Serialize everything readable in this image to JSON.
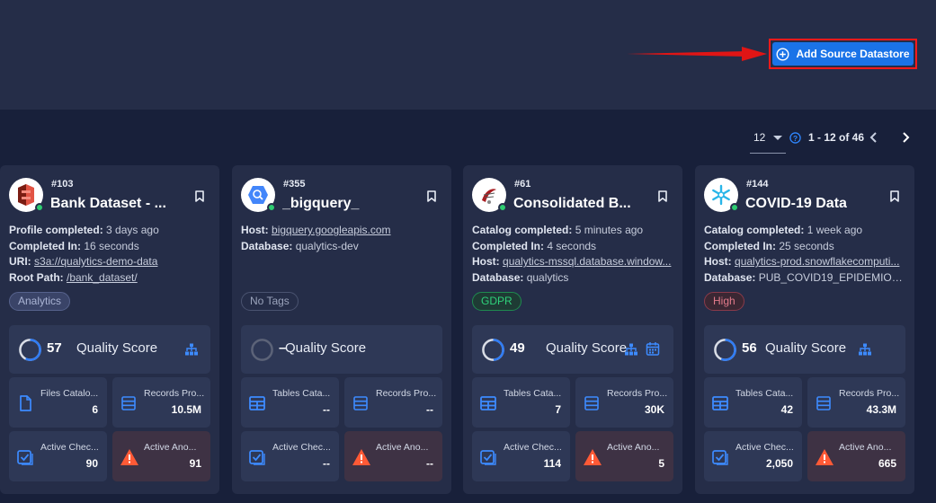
{
  "header": {
    "add_button_label": "Add Source Datastore"
  },
  "pagination": {
    "page_size": "12",
    "range": "1 - 12 of 46"
  },
  "cards": [
    {
      "id": "#103",
      "name": "Bank Dataset - ...",
      "logo": "aws-s3-icon",
      "status_color": "#2ecc71",
      "details": [
        {
          "label": "Profile completed:",
          "value": "3 days ago",
          "link": false
        },
        {
          "label": "Completed In:",
          "value": "16 seconds",
          "link": false
        },
        {
          "label": "URI:",
          "value": "s3a://qualytics-demo-data",
          "link": true
        },
        {
          "label": "Root Path:",
          "value": "/bank_dataset/",
          "link": true
        }
      ],
      "tag": "Analytics",
      "quality_score": "57",
      "quality_score_label": "Quality Score",
      "quality_score_fraction": 0.57,
      "stats": [
        {
          "label": "Files Catalo...",
          "value": "6",
          "icon": "file-icon"
        },
        {
          "label": "Records Pro...",
          "value": "10.5M",
          "icon": "records-icon"
        },
        {
          "label": "Active Chec...",
          "value": "90",
          "icon": "checks-icon"
        },
        {
          "label": "Active Ano...",
          "value": "91",
          "icon": "warning-icon"
        }
      ]
    },
    {
      "id": "#355",
      "name": "_bigquery_",
      "logo": "bigquery-icon",
      "status_color": "#2ecc71",
      "details": [
        {
          "label": "Host:",
          "value": "bigquery.googleapis.com",
          "link": true
        },
        {
          "label": "Database:",
          "value": "qualytics-dev",
          "link": false
        }
      ],
      "tag": "No Tags",
      "quality_score": "–",
      "quality_score_label": "Quality Score",
      "quality_score_fraction": 0,
      "stats": [
        {
          "label": "Tables Cata...",
          "value": "--",
          "icon": "table-icon"
        },
        {
          "label": "Records Pro...",
          "value": "--",
          "icon": "records-icon"
        },
        {
          "label": "Active Chec...",
          "value": "--",
          "icon": "checks-icon"
        },
        {
          "label": "Active Ano...",
          "value": "--",
          "icon": "warning-icon"
        }
      ]
    },
    {
      "id": "#61",
      "name": "Consolidated B...",
      "logo": "sql-server-icon",
      "status_color": "#2ecc71",
      "details": [
        {
          "label": "Catalog completed:",
          "value": "5 minutes ago",
          "link": false
        },
        {
          "label": "Completed In:",
          "value": "4 seconds",
          "link": false
        },
        {
          "label": "Host:",
          "value": "qualytics-mssql.database.window...",
          "link": true
        },
        {
          "label": "Database:",
          "value": "qualytics",
          "link": false
        }
      ],
      "tag": "GDPR",
      "quality_score": "49",
      "quality_score_label": "Quality Score",
      "quality_score_fraction": 0.49,
      "stats": [
        {
          "label": "Tables Cata...",
          "value": "7",
          "icon": "table-icon"
        },
        {
          "label": "Records Pro...",
          "value": "30K",
          "icon": "records-icon"
        },
        {
          "label": "Active Chec...",
          "value": "114",
          "icon": "checks-icon"
        },
        {
          "label": "Active Ano...",
          "value": "5",
          "icon": "warning-icon"
        }
      ]
    },
    {
      "id": "#144",
      "name": "COVID-19 Data",
      "logo": "snowflake-icon",
      "status_color": "#2ecc71",
      "details": [
        {
          "label": "Catalog completed:",
          "value": "1 week ago",
          "link": false
        },
        {
          "label": "Completed In:",
          "value": "25 seconds",
          "link": false
        },
        {
          "label": "Host:",
          "value": "qualytics-prod.snowflakecomputi...",
          "link": true
        },
        {
          "label": "Database:",
          "value": "PUB_COVID19_EPIDEMIOLO...",
          "link": false
        }
      ],
      "tag": "High",
      "quality_score": "56",
      "quality_score_label": "Quality Score",
      "quality_score_fraction": 0.56,
      "stats": [
        {
          "label": "Tables Cata...",
          "value": "42",
          "icon": "table-icon"
        },
        {
          "label": "Records Pro...",
          "value": "43.3M",
          "icon": "records-icon"
        },
        {
          "label": "Active Chec...",
          "value": "2,050",
          "icon": "checks-icon"
        },
        {
          "label": "Active Ano...",
          "value": "665",
          "icon": "warning-icon"
        }
      ]
    }
  ]
}
